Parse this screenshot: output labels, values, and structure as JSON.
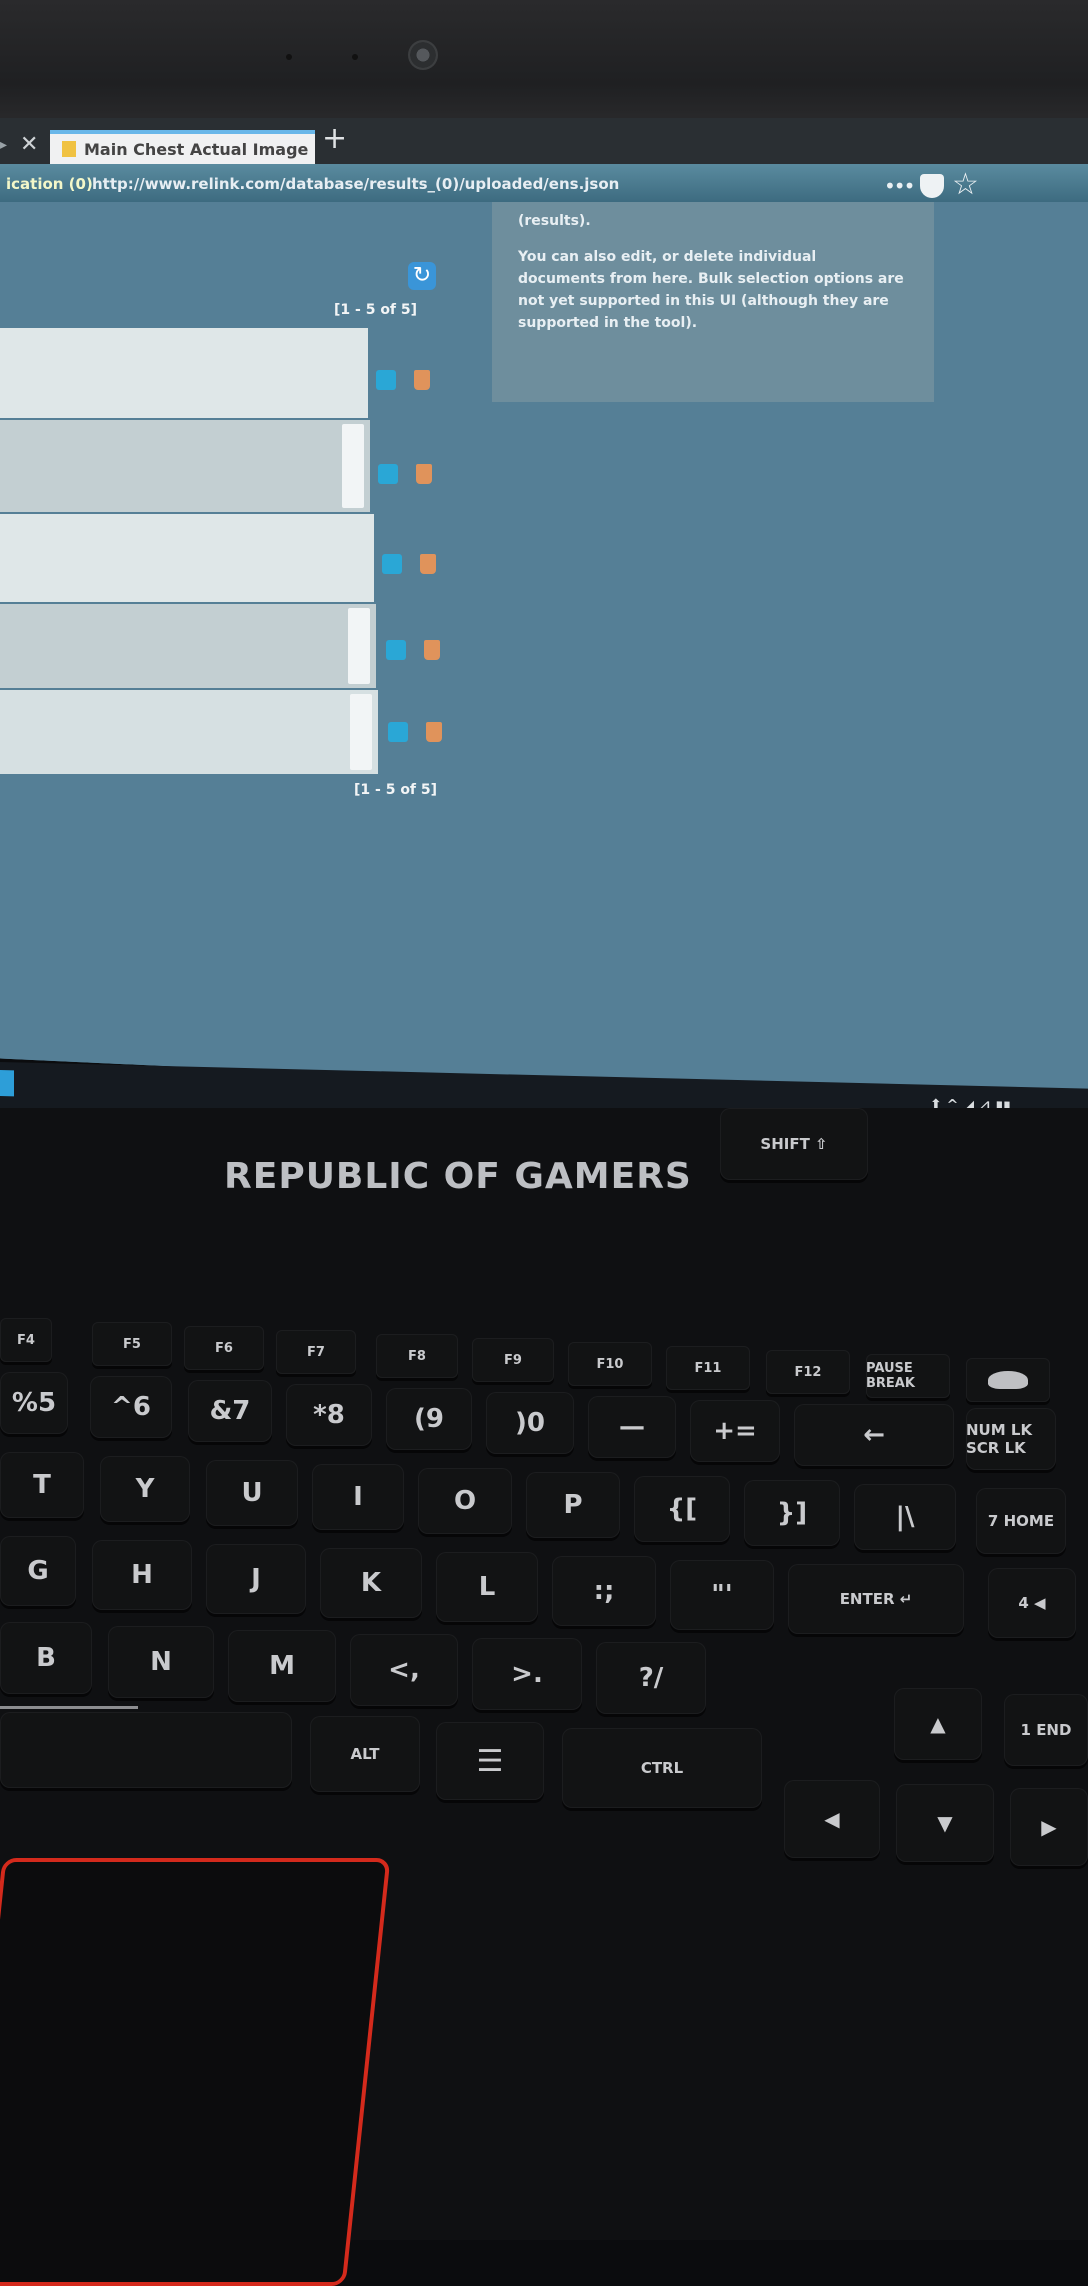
{
  "browser": {
    "tab_title": "Main Chest Actual Image",
    "tab_close": "✕",
    "prev_tab_close": "✕",
    "new_tab": "+",
    "insecure_label": "ication (0)",
    "url": "http://www.relink.com/database/results_(0)/uploaded/ens.json",
    "more": "•••",
    "star": "☆"
  },
  "page": {
    "info_card": {
      "paragraph1": "(results).",
      "paragraph2": "You can also edit, or delete individual documents from here. Bulk selection options are not yet supported in this UI (although they are supported in the tool)."
    },
    "count_top": "[1 - 5 of 5]",
    "count_bottom": "[1 - 5 of 5]",
    "refresh_glyph": "↻",
    "rows": [
      {
        "shade": "light"
      },
      {
        "shade": "dark"
      },
      {
        "shade": "light"
      },
      {
        "shade": "dark"
      },
      {
        "shade": "light"
      }
    ]
  },
  "taskbar": {
    "tray": "⬆ ^ ◢ ⊿ ▮▮"
  },
  "laptop": {
    "brand": "REPUBLIC OF GAMERS",
    "accent_color": "#d42a1c"
  },
  "keyboard": {
    "fn_row": [
      "F4",
      "F5",
      "F6",
      "F7",
      "F8",
      "F9",
      "F10",
      "F11",
      "F12",
      "PAUSE BREAK"
    ],
    "number_row": [
      "%5",
      "^6",
      "&7",
      "*8",
      "(9",
      ")0",
      "—",
      "+=",
      "←"
    ],
    "top_row": [
      "T",
      "Y",
      "U",
      "I",
      "O",
      "P",
      "{[",
      "}]",
      "|\\"
    ],
    "home_row": [
      "G",
      "H",
      "J",
      "K",
      "L",
      ":;",
      "\"'",
      "ENTER ↵"
    ],
    "bottom_row": [
      "B",
      "N",
      "M",
      "<,",
      ">.",
      "?/",
      "SHIFT ⇧"
    ],
    "space_row": [
      "ALT",
      "☰",
      "CTRL"
    ],
    "arrows": [
      "▲",
      "◀",
      "▼",
      "▶"
    ],
    "numpad": [
      "7 HOME",
      "4 ◀",
      "1 END",
      "NUM LK SCR LK"
    ]
  }
}
